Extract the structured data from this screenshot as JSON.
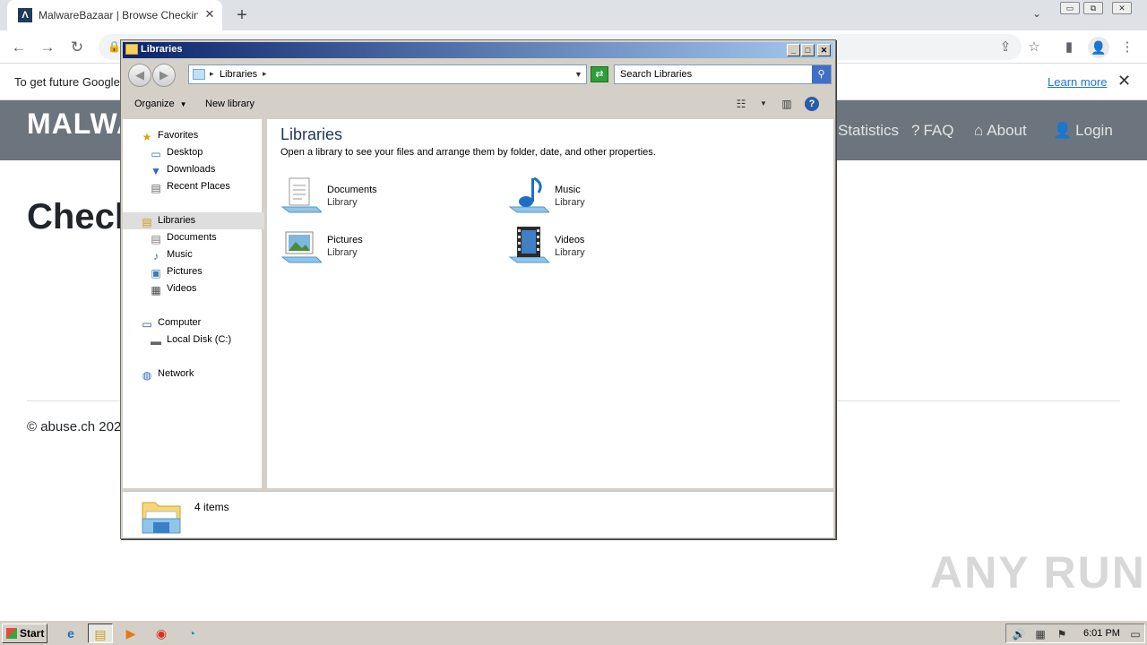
{
  "browser": {
    "tab_title": "MalwareBazaar | Browse Checking y",
    "tab_favicon": "Λ",
    "tab_close": "✕",
    "new_tab": "+",
    "tab_menu": "⌄",
    "window_controls": [
      "▭",
      "⧉",
      "✕"
    ],
    "nav": {
      "back": "←",
      "forward": "→",
      "reload": "↻"
    },
    "lock": "🔒",
    "toolbar_icons": {
      "share": "⇪",
      "bookmark": "☆",
      "sidepanel": "▮",
      "profile": "👤",
      "menu": "⋮"
    },
    "infobar": {
      "text": "To get future Google",
      "learn_more": "Learn more",
      "close": "✕"
    }
  },
  "page": {
    "brand": "MALWA",
    "nav": [
      {
        "icon": "",
        "label": "Statistics"
      },
      {
        "icon": "?",
        "label": "FAQ"
      },
      {
        "icon": "⌂",
        "label": "About"
      },
      {
        "icon": "👤",
        "label": "Login"
      }
    ],
    "heading": "Check",
    "footer": "© abuse.ch 202",
    "watermark": "ANY RUN"
  },
  "explorer": {
    "title": "Libraries",
    "caption_buttons": [
      "_",
      "□",
      "✕"
    ],
    "back": "◀",
    "forward": "▶",
    "address": {
      "arrow": "▸",
      "path": "Libraries",
      "path_arrow": "▸",
      "dropdown": "▼"
    },
    "refresh": "⇄",
    "search_placeholder": "Search Libraries",
    "search_icon": "⚲",
    "toolbar": {
      "organize": "Organize",
      "organize_arrow": "▼",
      "new_library": "New library",
      "view_arrow": "▼",
      "view_icon": "☷",
      "preview_icon": "▥",
      "help_icon": "?"
    },
    "nav_pane": {
      "favorites": {
        "label": "Favorites",
        "icon": "★"
      },
      "favorites_items": [
        {
          "label": "Desktop",
          "icon": "▭"
        },
        {
          "label": "Downloads",
          "icon": "▼"
        },
        {
          "label": "Recent Places",
          "icon": "▤"
        }
      ],
      "libraries": {
        "label": "Libraries",
        "icon": "▤"
      },
      "libraries_items": [
        {
          "label": "Documents",
          "icon": "▤"
        },
        {
          "label": "Music",
          "icon": "♪"
        },
        {
          "label": "Pictures",
          "icon": "▣"
        },
        {
          "label": "Videos",
          "icon": "▦"
        }
      ],
      "computer": {
        "label": "Computer",
        "icon": "▭"
      },
      "computer_items": [
        {
          "label": "Local Disk (C:)",
          "icon": "▬"
        }
      ],
      "network": {
        "label": "Network",
        "icon": "◍"
      }
    },
    "content": {
      "title": "Libraries",
      "description": "Open a library to see your files and arrange them by folder, date, and other properties.",
      "libraries": [
        {
          "name": "Documents",
          "type": "Library",
          "icon": "documents-library-icon"
        },
        {
          "name": "Music",
          "type": "Library",
          "icon": "music-library-icon"
        },
        {
          "name": "Pictures",
          "type": "Library",
          "icon": "pictures-library-icon"
        },
        {
          "name": "Videos",
          "type": "Library",
          "icon": "videos-library-icon"
        }
      ]
    },
    "details": {
      "count": "4 items"
    }
  },
  "taskbar": {
    "start": "Start",
    "apps": [
      {
        "name": "internet-explorer",
        "glyph": "e"
      },
      {
        "name": "explorer",
        "glyph": "▤"
      },
      {
        "name": "media-player",
        "glyph": "▶"
      },
      {
        "name": "chrome",
        "glyph": "◉"
      },
      {
        "name": "edge",
        "glyph": "◔"
      }
    ],
    "tray_icons": [
      "🔊",
      "▦",
      "⚑",
      "▭"
    ],
    "time": "6:01 PM"
  },
  "colors": {
    "titlebar_start": "#0a246a",
    "titlebar_end": "#a6caf0",
    "site_header": "#6c757d",
    "link": "#1a73e8",
    "window_face": "#d4d0c8"
  }
}
